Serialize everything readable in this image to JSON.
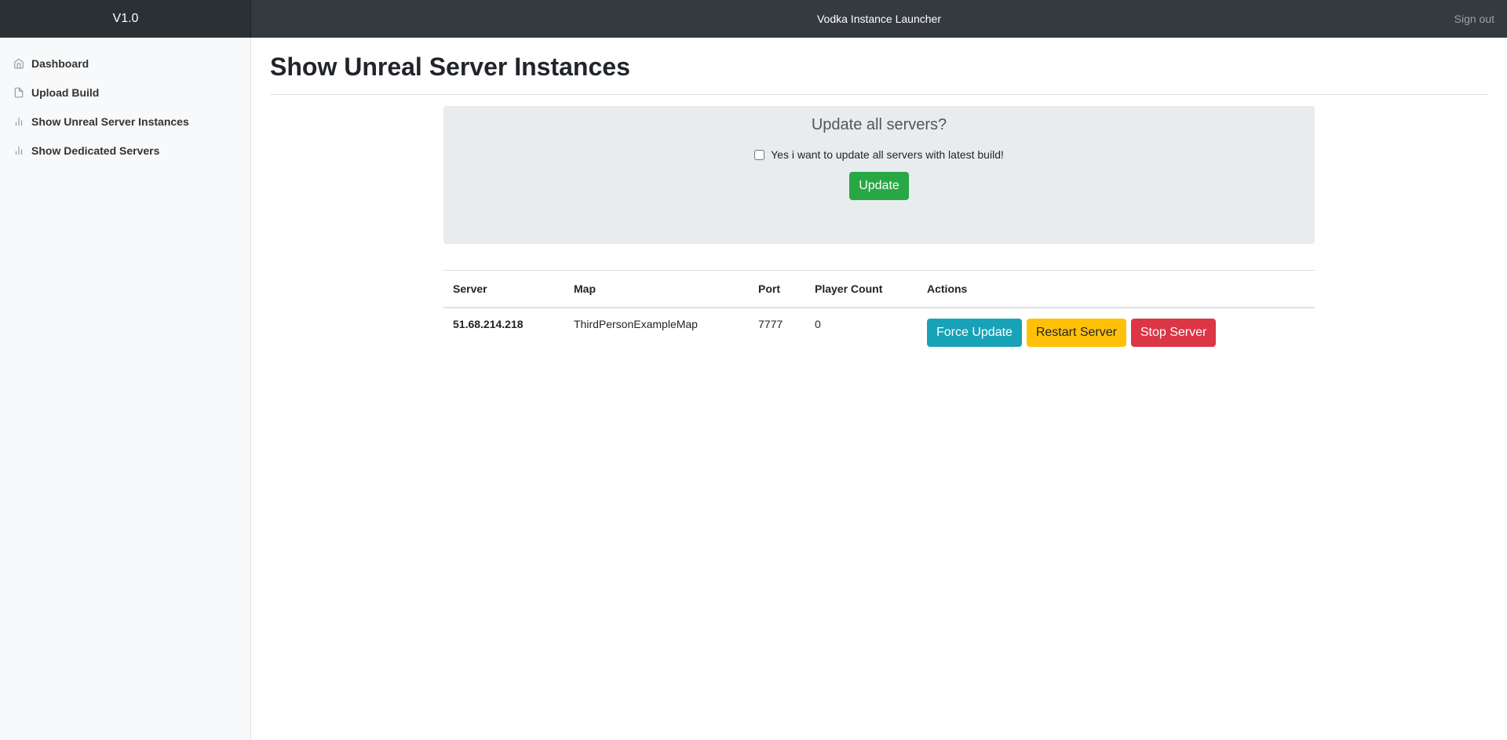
{
  "navbar": {
    "version": "V1.0",
    "title": "Vodka Instance Launcher",
    "signout": "Sign out"
  },
  "sidebar": {
    "items": [
      {
        "label": "Dashboard",
        "icon": "home-icon"
      },
      {
        "label": "Upload Build",
        "icon": "file-icon"
      },
      {
        "label": "Show Unreal Server Instances",
        "icon": "bar-chart-icon"
      },
      {
        "label": "Show Dedicated Servers",
        "icon": "bar-chart-icon"
      }
    ]
  },
  "main": {
    "title": "Show Unreal Server Instances",
    "update_panel": {
      "heading": "Update all servers?",
      "checkbox_label": "Yes i want to update all servers with latest build!",
      "checkbox_checked": false,
      "button": "Update"
    },
    "table": {
      "headers": [
        "Server",
        "Map",
        "Port",
        "Player Count",
        "Actions"
      ],
      "rows": [
        {
          "server": "51.68.214.218",
          "map": "ThirdPersonExampleMap",
          "port": "7777",
          "player_count": "0",
          "actions": [
            "Force Update",
            "Restart Server",
            "Stop Server"
          ]
        }
      ]
    }
  },
  "colors": {
    "navbar": "#343a40",
    "success": "#28a745",
    "info": "#17a2b8",
    "warning": "#ffc107",
    "danger": "#dc3545"
  }
}
